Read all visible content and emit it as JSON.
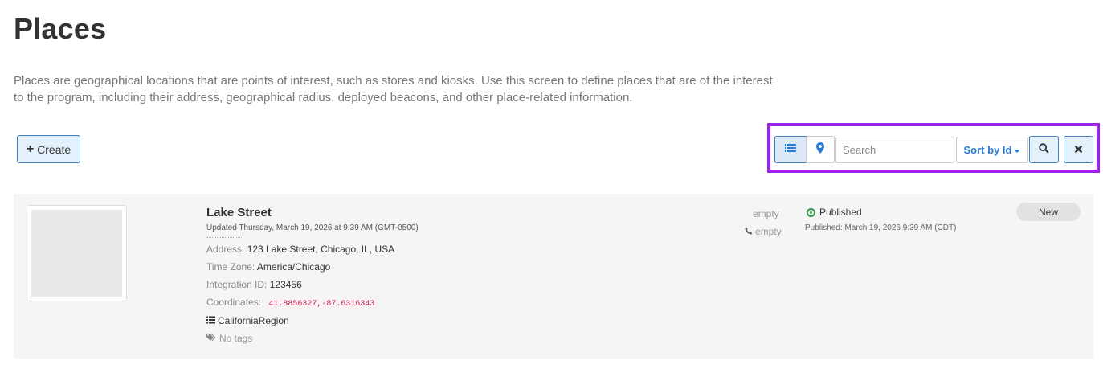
{
  "page": {
    "title": "Places",
    "description": "Places are geographical locations that are points of interest, such as stores and kiosks. Use this screen to define places that are of the interest to the program, including their address, geographical radius, deployed beacons, and other place-related information."
  },
  "toolbar": {
    "create_label": "Create",
    "search_placeholder": "Search",
    "search_value": "",
    "sort_label": "Sort by Id",
    "active_view": "list",
    "highlight_color": "#a020f0",
    "accent_color": "#2a7ad4"
  },
  "places": [
    {
      "name": "Lake Street",
      "updated": "Updated Thursday, March 19, 2026 at 9:39 AM (GMT-0500)",
      "address_label": "Address:",
      "address": "123 Lake Street, Chicago, IL, USA",
      "timezone_label": "Time Zone:",
      "timezone": "America/Chicago",
      "integration_label": "Integration ID:",
      "integration_id": "123456",
      "coordinates_label": "Coordinates:",
      "coordinates": "41.8856327,-87.6316343",
      "region": "CaliforniaRegion",
      "tags": "No tags",
      "email": "empty",
      "phone": "empty",
      "status": "Published",
      "published_detail": "Published: March 19, 2026 9:39 AM (CDT)",
      "badge": "New",
      "status_color": "#2e9e4a"
    }
  ]
}
